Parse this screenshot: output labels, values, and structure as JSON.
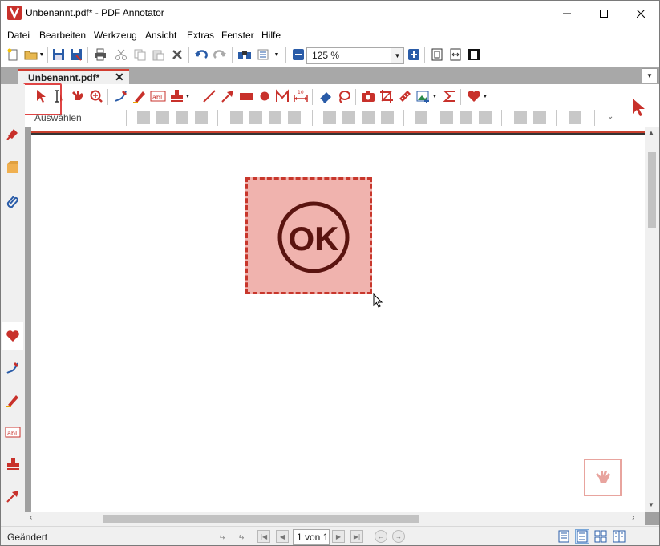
{
  "window": {
    "title": "Unbenannt.pdf* - PDF Annotator",
    "minimize_icon": "minimize-icon",
    "maximize_icon": "maximize-icon",
    "close_icon": "close-icon"
  },
  "menu": {
    "items": [
      "Datei",
      "Bearbeiten",
      "Werkzeug",
      "Ansicht",
      "Extras",
      "Fenster",
      "Hilfe"
    ]
  },
  "toolbar": {
    "zoom_value": "125 %"
  },
  "tabs": {
    "active_label": "Unbenannt.pdf*",
    "close_glyph": "✕"
  },
  "annotation_toolbar": {
    "tool_label": "Auswählen",
    "accent_color": "#c8312b"
  },
  "document": {
    "stamp_text": "OK",
    "stamp_fill": "#f0b3ae",
    "stamp_border": "#c8372c"
  },
  "statusbar": {
    "status": "Geändert",
    "page_indicator": "1 von 1"
  }
}
